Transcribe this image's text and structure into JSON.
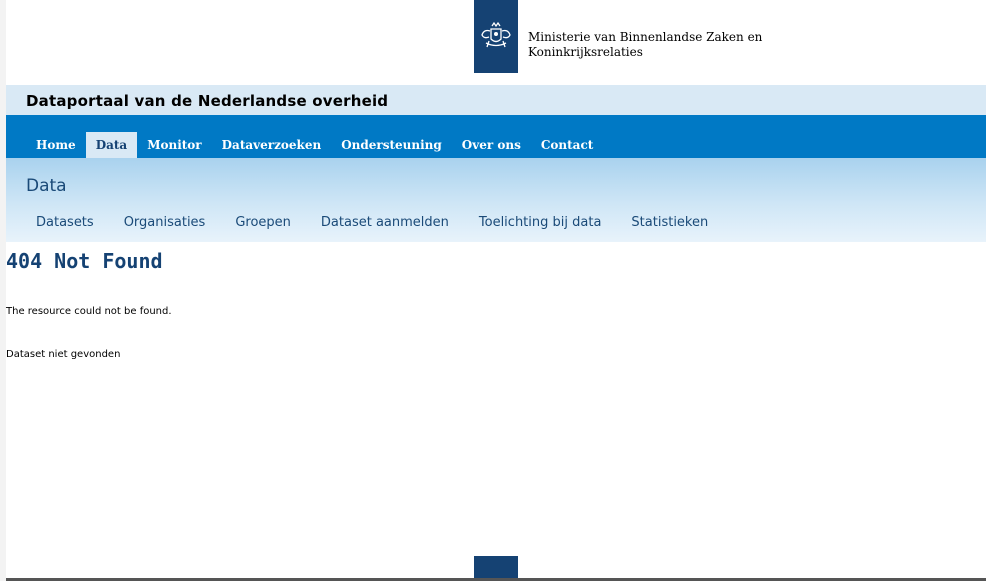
{
  "header": {
    "logo_icon": "rijksoverheid-crest-icon",
    "ministry_line1": "Ministerie van Binnenlandse Zaken en",
    "ministry_line2": "Koninkrijksrelaties"
  },
  "portal": {
    "title": "Dataportaal van de Nederlandse overheid"
  },
  "main_nav": {
    "items": [
      {
        "label": "Home"
      },
      {
        "label": "Data",
        "active": true
      },
      {
        "label": "Monitor"
      },
      {
        "label": "Dataverzoeken"
      },
      {
        "label": "Ondersteuning"
      },
      {
        "label": "Over ons"
      },
      {
        "label": "Contact"
      }
    ]
  },
  "section": {
    "title": "Data",
    "sub_nav": [
      {
        "label": "Datasets"
      },
      {
        "label": "Organisaties"
      },
      {
        "label": "Groepen"
      },
      {
        "label": "Dataset aanmelden"
      },
      {
        "label": "Toelichting bij data"
      },
      {
        "label": "Statistieken"
      }
    ]
  },
  "content": {
    "error_title": "404 Not Found",
    "message": "The resource could not be found.",
    "detail": "Dataset niet gevonden"
  },
  "colors": {
    "brand_dark": "#154273",
    "nav_blue": "#0079c5",
    "light_blue": "#d9e9f5"
  }
}
